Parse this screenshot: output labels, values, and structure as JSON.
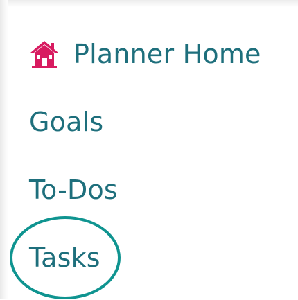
{
  "nav": {
    "home": {
      "label": "Planner Home",
      "icon": "house-icon"
    },
    "items": [
      {
        "label": "Goals"
      },
      {
        "label": "To-Dos"
      },
      {
        "label": "Tasks"
      }
    ]
  },
  "colors": {
    "link": "#1e6f7c",
    "home_icon": "#d81b60",
    "highlight": "#0f9490"
  }
}
